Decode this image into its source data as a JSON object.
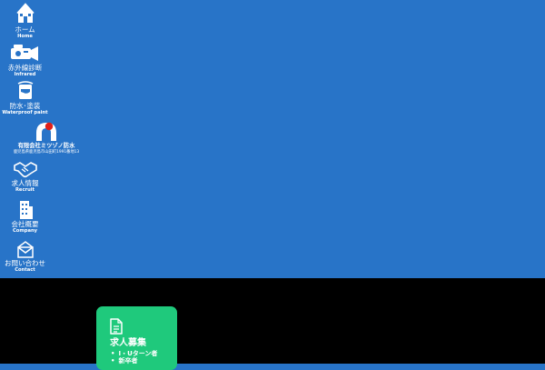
{
  "nav": {
    "items": [
      {
        "label": "ホーム",
        "sub": "Home",
        "icon": "house-icon"
      },
      {
        "label": "赤外線診断",
        "sub": "Infrared",
        "icon": "infrared-camera-icon"
      },
      {
        "label": "防水･塗装",
        "sub": "Waterproof paint",
        "icon": "paint-can-icon"
      },
      {
        "label": "求人情報",
        "sub": "Recruit",
        "icon": "handshake-icon"
      },
      {
        "label": "会社概要",
        "sub": "Company",
        "icon": "building-icon"
      },
      {
        "label": "お問い合わせ",
        "sub": "Contact",
        "icon": "envelope-icon"
      }
    ]
  },
  "company": {
    "name": "有限会社ミツゾノ防水",
    "address": "鹿児島県鹿児島市山田町1991番地13",
    "logo_icon": "company-logo-icon"
  },
  "recruit_card": {
    "icon": "document-icon",
    "title": "求人募集",
    "items": [
      "I・Uターン者",
      "新卒者"
    ]
  },
  "colors": {
    "background": "#2874c8",
    "footer": "#000000",
    "card": "#1fc97c",
    "logo_accent": "#e0201a"
  }
}
